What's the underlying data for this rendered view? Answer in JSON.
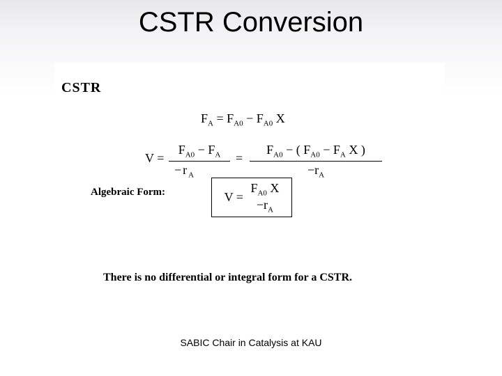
{
  "title": "CSTR Conversion",
  "section_label": "CSTR",
  "equation1": {
    "lhs": "F",
    "lhs_sub": "A",
    "eq": " = ",
    "t1": "F",
    "t1_sub": "A0",
    "minus": " − ",
    "t2": "F",
    "t2_sub": "A0",
    "x": "X"
  },
  "equation2": {
    "v": "V",
    "eq": " = ",
    "num1_a": "F",
    "num1_a_sub": "A0",
    "num1_minus": " − ",
    "num1_b": "F",
    "num1_b_sub": "A",
    "den1": "−r",
    "den1_sub": "A",
    "mideq": " = ",
    "num2_a": "F",
    "num2_a_sub": "A0",
    "num2_minus": " − (",
    "num2_b": "F",
    "num2_b_sub": "A0",
    "num2_minus2": " − ",
    "num2_c": "F",
    "num2_c_sub": "A",
    "num2_x": "X",
    "num2_close": ")",
    "den2": "−r",
    "den2_sub": "A"
  },
  "algebraic_label": "Algebraic Form:",
  "boxed": {
    "v": "V",
    "eq": " = ",
    "num_a": "F",
    "num_a_sub": "A0",
    "num_x": "X",
    "den": "−r",
    "den_sub": "A"
  },
  "note": "There is no differential or integral form for a CSTR.",
  "footer": "SABIC Chair in Catalysis at KAU"
}
